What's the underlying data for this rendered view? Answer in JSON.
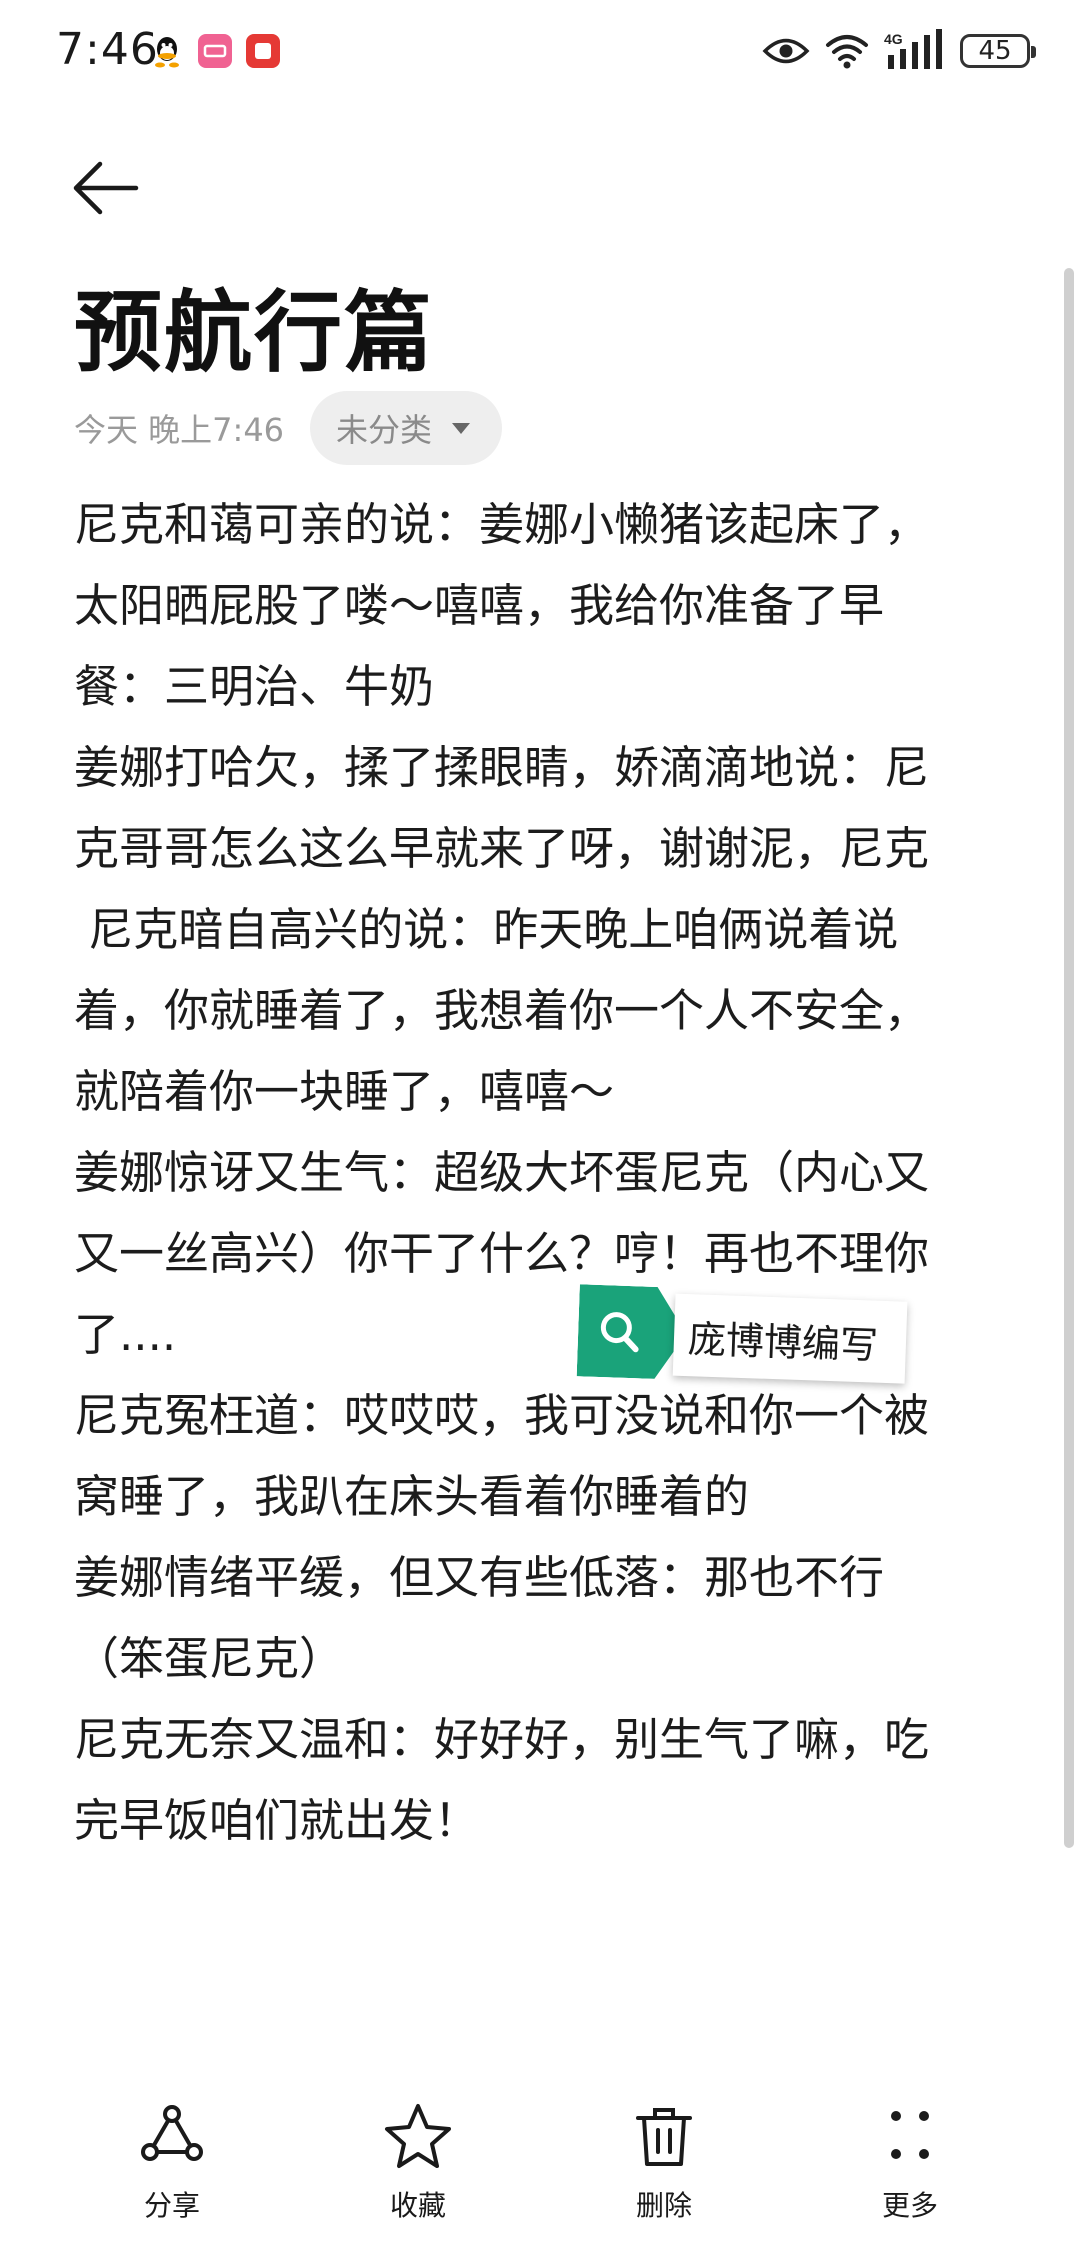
{
  "status_bar": {
    "time": "7:46",
    "network": "4G",
    "battery": "45"
  },
  "note": {
    "title": "预航行篇",
    "timestamp": "今天 晚上7:46",
    "category": "未分类",
    "lines": [
      "尼克和蔼可亲的说：姜娜小懒猪该起床了，",
      "太阳晒屁股了喽～嘻嘻，我给你准备了早",
      "餐：三明治、牛奶",
      "姜娜打哈欠，揉了揉眼睛，娇滴滴地说：尼",
      "克哥哥怎么这么早就来了呀，谢谢泥，尼克",
      " 尼克暗自高兴的说：昨天晚上咱俩说着说",
      "着，你就睡着了，我想着你一个人不安全，",
      "就陪着你一块睡了，嘻嘻～",
      "姜娜惊讶又生气：超级大坏蛋尼克（内心又",
      "又一丝高兴）你干了什么？哼！再也不理你",
      "了....",
      "尼克冤枉道：哎哎哎，我可没说和你一个被",
      "窝睡了，我趴在床头看着你睡着的",
      "姜娜情绪平缓，但又有些低落：那也不行",
      "（笨蛋尼克）",
      "尼克无奈又温和：好好好，别生气了嘛，吃",
      "完早饭咱们就出发！"
    ]
  },
  "watermark": {
    "text": "庞博博编写"
  },
  "toolbar": {
    "share_label": "分享",
    "favorite_label": "收藏",
    "delete_label": "删除",
    "more_label": "更多"
  },
  "icons": {
    "back": "arrow-left-icon",
    "category_dropdown": "caret-down-icon",
    "share": "share-icon",
    "favorite": "star-icon",
    "delete": "trash-icon",
    "more": "more-dots-icon",
    "watermark": "search-icon"
  },
  "colors": {
    "watermark_green": "#1aa37a"
  }
}
